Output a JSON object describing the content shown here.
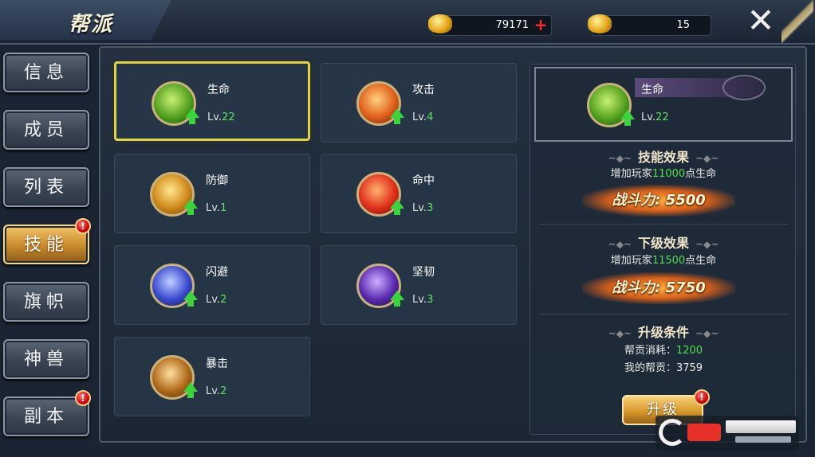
{
  "header": {
    "title": "帮派",
    "gold": {
      "icon": "gold-ingot-icon",
      "value": "79171",
      "add_icon": "plus-icon"
    },
    "currency2": {
      "icon": "gold-coin-icon",
      "value": "15"
    },
    "close_icon": "close-icon"
  },
  "sidebar": {
    "items": [
      {
        "label": "信息",
        "active": false,
        "badge": false
      },
      {
        "label": "成员",
        "active": false,
        "badge": false
      },
      {
        "label": "列表",
        "active": false,
        "badge": false
      },
      {
        "label": "技能",
        "active": true,
        "badge": true
      },
      {
        "label": "旗帜",
        "active": false,
        "badge": false
      },
      {
        "label": "神兽",
        "active": false,
        "badge": false
      },
      {
        "label": "副本",
        "active": false,
        "badge": true
      }
    ],
    "badge_mark": "!"
  },
  "skills": [
    {
      "name": "生命",
      "lv_prefix": "Lv.",
      "level": "22",
      "selected": true,
      "icon": "life-skill-icon"
    },
    {
      "name": "攻击",
      "lv_prefix": "Lv.",
      "level": "4",
      "selected": false,
      "icon": "attack-skill-icon"
    },
    {
      "name": "防御",
      "lv_prefix": "Lv.",
      "level": "1",
      "selected": false,
      "icon": "defense-skill-icon"
    },
    {
      "name": "命中",
      "lv_prefix": "Lv.",
      "level": "3",
      "selected": false,
      "icon": "hit-skill-icon"
    },
    {
      "name": "闪避",
      "lv_prefix": "Lv.",
      "level": "2",
      "selected": false,
      "icon": "dodge-skill-icon"
    },
    {
      "name": "坚韧",
      "lv_prefix": "Lv.",
      "level": "3",
      "selected": false,
      "icon": "tenacity-skill-icon"
    },
    {
      "name": "暴击",
      "lv_prefix": "Lv.",
      "level": "2",
      "selected": false,
      "icon": "crit-skill-icon"
    }
  ],
  "detail": {
    "name": "生命",
    "lv_prefix": "Lv.",
    "level": "22",
    "effect_title": "技能效果",
    "effect_pre": "增加玩家",
    "effect_value": "11000",
    "effect_post": "点生命",
    "effect_power": "战斗力: 5500",
    "next_title": "下级效果",
    "next_pre": "增加玩家",
    "next_value": "11500",
    "next_post": "点生命",
    "next_power": "战斗力: 5750",
    "cond_title": "升级条件",
    "cost_label": "帮贡消耗：",
    "cost_value": "1200",
    "mine_label": "我的帮贡：",
    "mine_value": "3759",
    "upgrade_label": "升级"
  },
  "colors": {
    "accent_gold": "#e6d23a",
    "level_green": "#5ee05e",
    "badge_red": "#d60000"
  }
}
